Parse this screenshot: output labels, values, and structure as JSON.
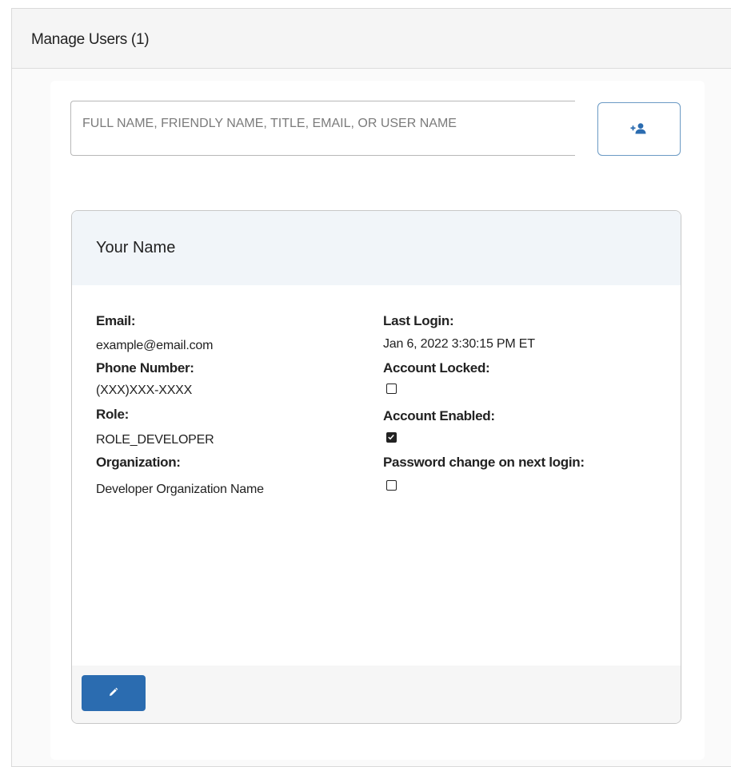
{
  "panel": {
    "title": "Manage Users (1)"
  },
  "search": {
    "placeholder": "FULL NAME, FRIENDLY NAME, TITLE, EMAIL, OR USER NAME"
  },
  "add_user_button": {
    "icon": "add-user-icon"
  },
  "user_card": {
    "name": "Your Name",
    "email_label": "Email:",
    "email": "example@email.com",
    "phone_label": "Phone Number:",
    "phone": "(XXX)XXX-XXXX",
    "role_label": "Role:",
    "role": "ROLE_DEVELOPER",
    "organization_label": "Organization:",
    "organization": "Developer Organization Name",
    "last_login_label": "Last Login:",
    "last_login": "Jan 6, 2022 3:30:15 PM ET",
    "account_locked_label": "Account Locked:",
    "account_locked": false,
    "account_enabled_label": "Account Enabled:",
    "account_enabled": true,
    "password_change_label": "Password change on next login:",
    "password_change": false,
    "edit_icon": "pencil-icon"
  },
  "colors": {
    "accent": "#2b6cb0",
    "card_header": "#f1f5f9"
  }
}
